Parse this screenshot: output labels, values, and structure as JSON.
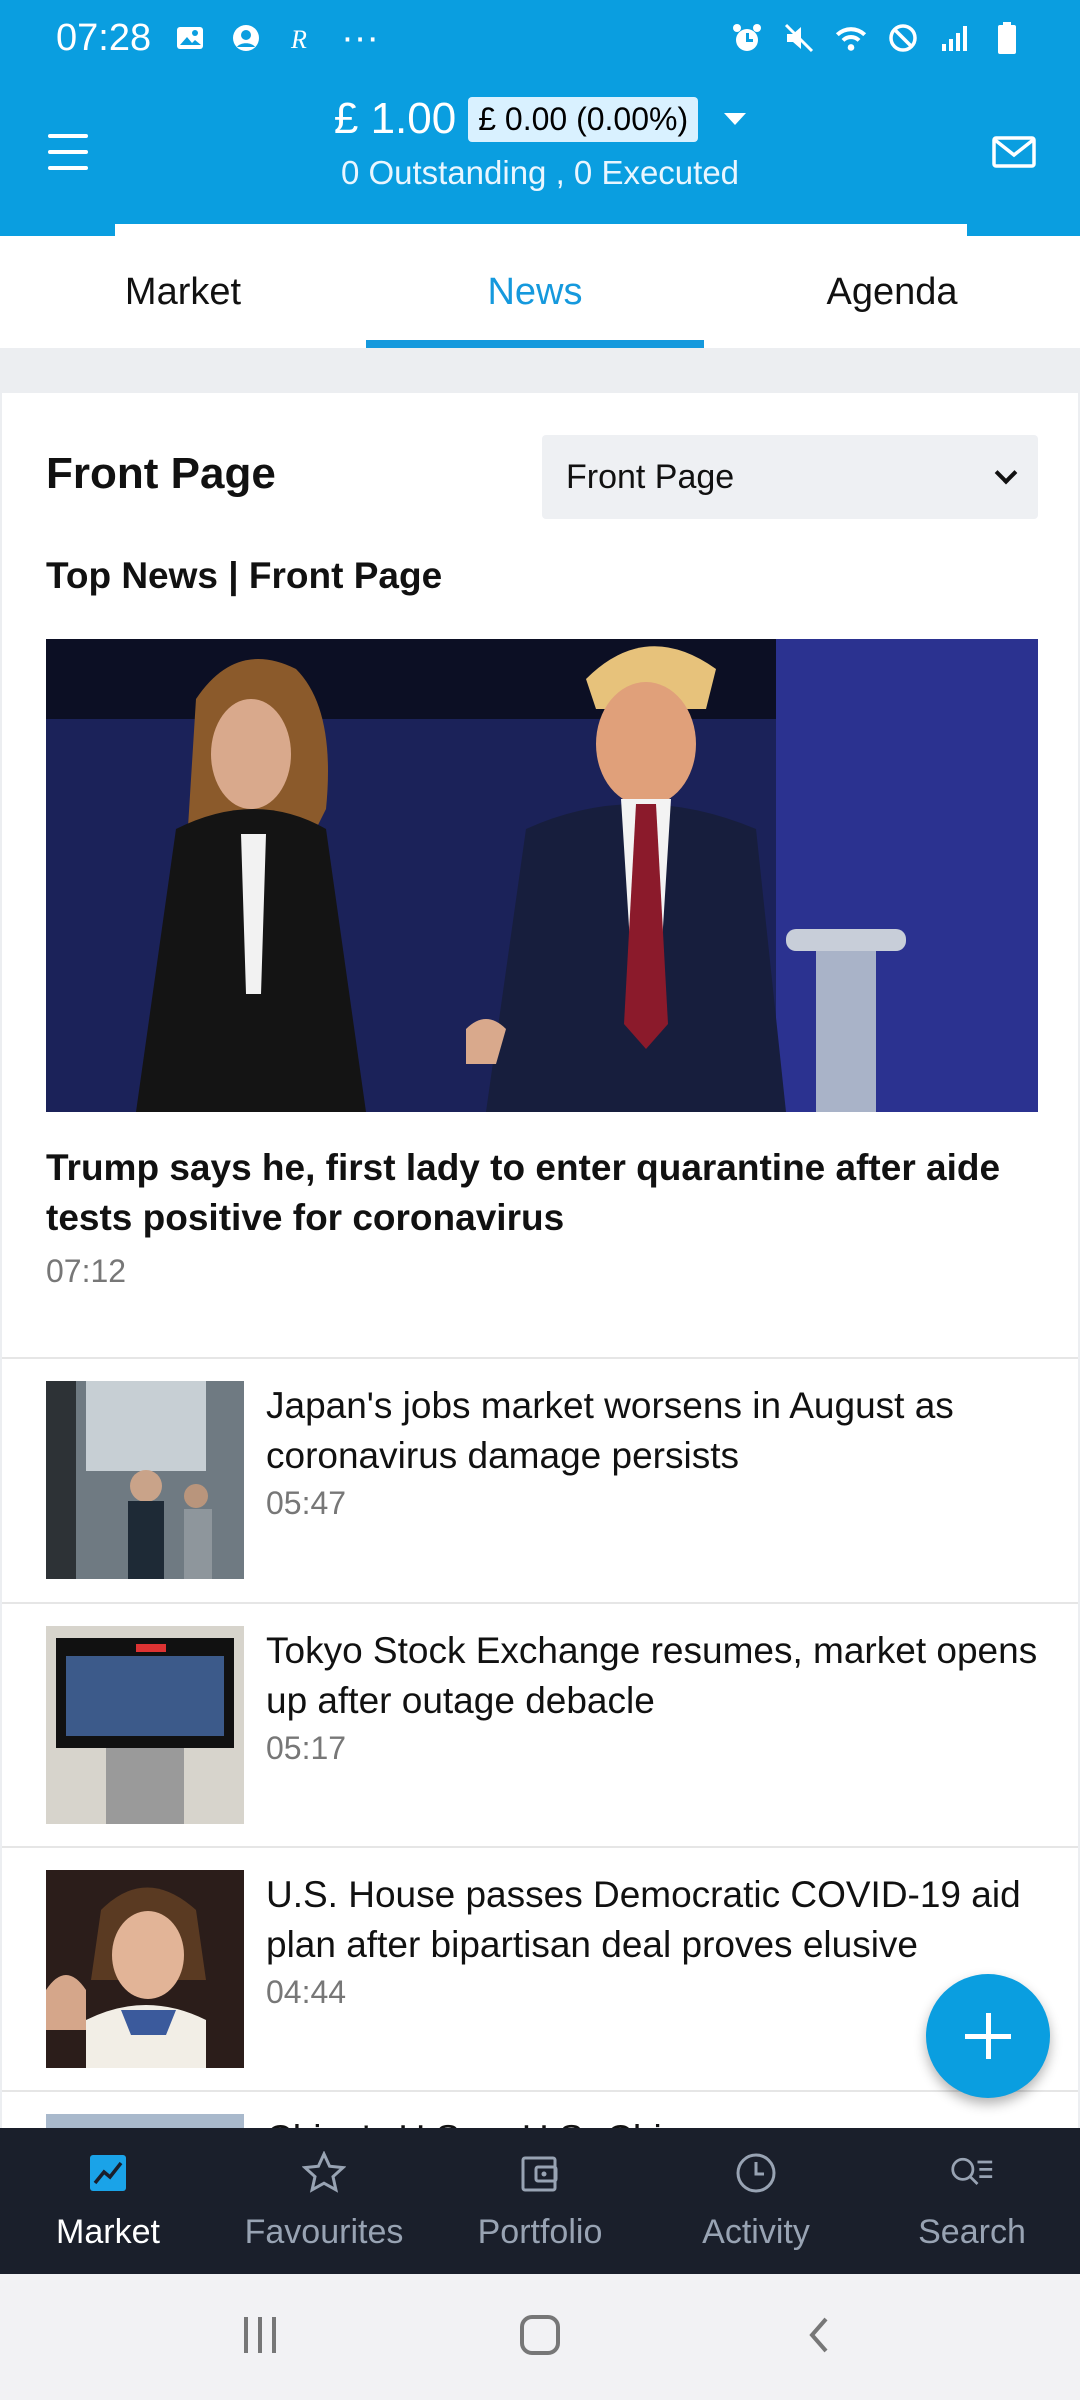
{
  "status_bar": {
    "time": "07:28",
    "more": "···"
  },
  "header": {
    "balance": "£ 1.00",
    "change": "£ 0.00 (0.00%)",
    "summary": "0 Outstanding , 0 Executed"
  },
  "tabs": [
    {
      "label": "Market",
      "active": false
    },
    {
      "label": "News",
      "active": true
    },
    {
      "label": "Agenda",
      "active": false
    }
  ],
  "news": {
    "page_title": "Front Page",
    "selector_value": "Front Page",
    "section_heading": "Top News | Front Page",
    "top_story": {
      "headline": "Trump says he, first lady to enter quarantine after aide tests positive for coronavirus",
      "time": "07:12"
    },
    "items": [
      {
        "headline": "Japan's jobs market worsens in August as coronavirus damage persists",
        "time": "05:47"
      },
      {
        "headline": "Tokyo Stock Exchange resumes, market opens up after outage debacle",
        "time": "05:17"
      },
      {
        "headline": "U.S. House passes Democratic COVID-19 aid plan after bipartisan deal proves elusive",
        "time": "04:44"
      },
      {
        "headline": "China's U.S. ... U.S.-China",
        "time": ""
      }
    ]
  },
  "bottom_nav": [
    {
      "label": "Market",
      "icon": "chart-icon",
      "active": true
    },
    {
      "label": "Favourites",
      "icon": "star-icon",
      "active": false
    },
    {
      "label": "Portfolio",
      "icon": "wallet-icon",
      "active": false
    },
    {
      "label": "Activity",
      "icon": "clock-icon",
      "active": false
    },
    {
      "label": "Search",
      "icon": "search-list-icon",
      "active": false
    }
  ],
  "colors": {
    "brand": "#0a9ee0",
    "accent": "#1599dd",
    "nav_bg": "#1a1f2b"
  }
}
